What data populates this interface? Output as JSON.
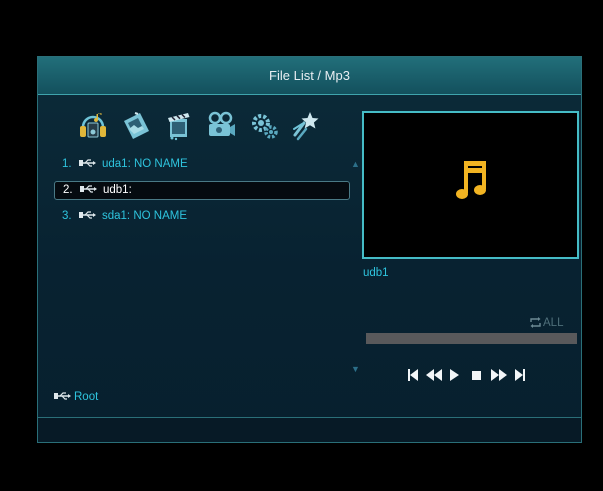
{
  "title": "File List / Mp3",
  "categories": [
    {
      "icon": "music-icon"
    },
    {
      "icon": "photo-icon"
    },
    {
      "icon": "movie-icon"
    },
    {
      "icon": "camera-icon"
    },
    {
      "icon": "settings-icon"
    },
    {
      "icon": "star-icon"
    }
  ],
  "devices": [
    {
      "number": "1.",
      "name": "uda1: NO NAME",
      "selected": false
    },
    {
      "number": "2.",
      "name": "udb1:",
      "selected": true
    },
    {
      "number": "3.",
      "name": "sda1: NO NAME",
      "selected": false
    }
  ],
  "preview": {
    "device_name": "udb1",
    "icon": "music-note-icon"
  },
  "repeat_mode": "ALL",
  "progress": 0,
  "controls": [
    "previous-track",
    "rewind",
    "play",
    "stop",
    "fast-forward",
    "next-track"
  ],
  "root_label": "Root",
  "colors": {
    "accent": "#45bcc6",
    "text": "#2ec4de",
    "note": "#f2b422"
  }
}
